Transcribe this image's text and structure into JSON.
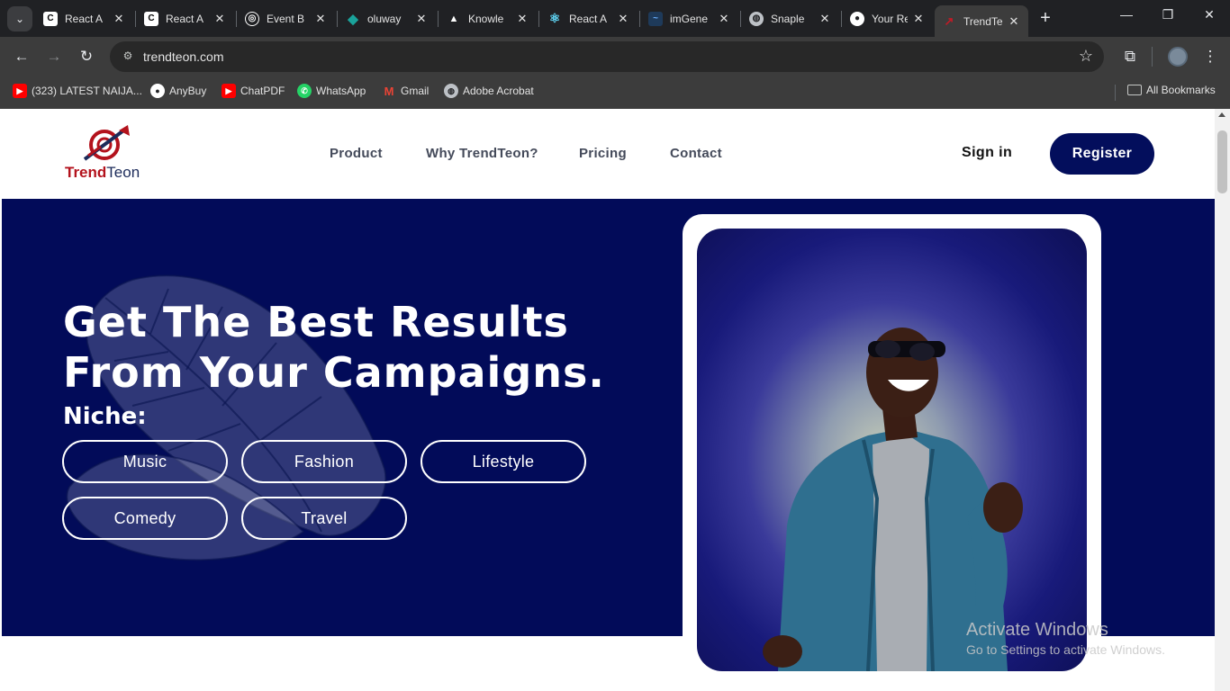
{
  "browser": {
    "tabs": [
      {
        "title": "React A",
        "favicon": "codesandbox-icon",
        "color": "#ffffff"
      },
      {
        "title": "React A",
        "favicon": "codesandbox-icon",
        "color": "#ffffff"
      },
      {
        "title": "Event B",
        "favicon": "openai-icon",
        "color": "#ffffff"
      },
      {
        "title": "oluway",
        "favicon": "diamond-icon",
        "color": "#1aa39b"
      },
      {
        "title": "Knowle",
        "favicon": "triangle-icon",
        "color": "#ffffff"
      },
      {
        "title": "React A",
        "favicon": "react-icon",
        "color": "#61dafb"
      },
      {
        "title": "imGene",
        "favicon": "wave-icon",
        "color": "#6ab0ff"
      },
      {
        "title": "Snaple",
        "favicon": "globe-icon",
        "color": "#bdc1c6"
      },
      {
        "title": "Your Re",
        "favicon": "github-icon",
        "color": "#ffffff"
      },
      {
        "title": "TrendTe",
        "favicon": "trendteon-icon",
        "color": "#c11a26",
        "active": true
      }
    ],
    "url": "trendteon.com",
    "bookmarks": [
      {
        "label": "(323) LATEST NAIJA...",
        "icon": "youtube-icon",
        "color": "#ff0000"
      },
      {
        "label": "AnyBuy",
        "icon": "github-icon",
        "color": "#ffffff"
      },
      {
        "label": "ChatPDF",
        "icon": "youtube-icon",
        "color": "#ff0000"
      },
      {
        "label": "WhatsApp",
        "icon": "whatsapp-icon",
        "color": "#25d366"
      },
      {
        "label": "Gmail",
        "icon": "gmail-icon",
        "color": "#ea4335"
      },
      {
        "label": "Adobe Acrobat",
        "icon": "globe-icon",
        "color": "#bdc1c6"
      }
    ],
    "all_bookmarks": "All Bookmarks"
  },
  "site": {
    "logo_text_trend": "Trend",
    "logo_text_teon": "Teon",
    "nav": [
      "Product",
      "Why TrendTeon?",
      "Pricing",
      "Contact"
    ],
    "sign_in": "Sign in",
    "register": "Register",
    "colors": {
      "brand_navy": "#030e5c",
      "brand_red": "#b3121c",
      "hero_bg": "#020b59"
    }
  },
  "hero": {
    "title_line1": "Get The Best Results",
    "title_line2": "From Your Campaigns.",
    "niche_label": "Niche:",
    "niches": [
      "Music",
      "Fashion",
      "Lifestyle",
      "Comedy",
      "Travel"
    ]
  },
  "os": {
    "watermark_title": "Activate Windows",
    "watermark_sub": "Go to Settings to activate Windows."
  }
}
